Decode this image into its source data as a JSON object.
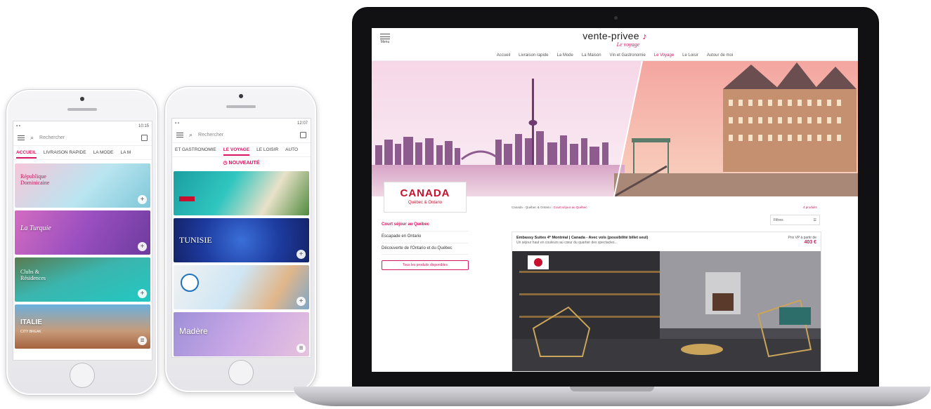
{
  "phone_left": {
    "status_time": "10:15",
    "search_placeholder": "Rechercher",
    "tabs": [
      "ACCUEIL",
      "LIVRAISON RAPIDE",
      "LA MODE",
      "LA M"
    ],
    "cards": [
      {
        "label": "République Dominicaine"
      },
      {
        "label": "La Turquie"
      },
      {
        "label": "Clubs & Résidences"
      },
      {
        "label": "ITALIE",
        "sub": "CITY BREAK"
      }
    ]
  },
  "phone_right": {
    "status_time": "12:07",
    "search_placeholder": "Rechercher",
    "tabs": [
      "ET GASTRONOMIE",
      "LE VOYAGE",
      "LE LOISIR",
      "AUTO"
    ],
    "section": "NOUVEAUTÉ",
    "cards": [
      {
        "label": ""
      },
      {
        "label": "TUNISIE"
      },
      {
        "label": ""
      },
      {
        "label": "Madère"
      }
    ]
  },
  "laptop": {
    "menu_label": "Menu",
    "logo_main": "vente-privee",
    "logo_sub": "Le voyage",
    "nav": [
      "Accueil",
      "Livraison rapide",
      "La Mode",
      "La Maison",
      "Vin et Gastronomie",
      "Le Voyage",
      "Le Loisir",
      "Autour de moi"
    ],
    "nav_active": "Le Voyage",
    "hero_title": "CANADA",
    "hero_subtitle": "Québec & Ontario",
    "sidebar": [
      {
        "label": "Court séjour au Québec",
        "active": true
      },
      {
        "label": "Escapade en Ontario",
        "active": false
      },
      {
        "label": "Découverte de l'Ontario et du Québec",
        "active": false
      }
    ],
    "sidebar_button": "Tous les produits disponibles",
    "breadcrumb": "Canada - Québec & Ontario",
    "breadcrumb_current": "Court séjour au Québec",
    "result_count": "4 produits",
    "filter_label": "Filtres",
    "product": {
      "title": "Embassy Suites 4* Montréal | Canada - Avec vols (possibilité billet seul)",
      "description": "Un séjour haut en couleurs au cœur du quartier des spectacles...",
      "price_label": "Prix VP à partir de",
      "price": "403 €"
    }
  },
  "colors": {
    "brand": "#d6145f",
    "canada_red": "#c8102e"
  }
}
